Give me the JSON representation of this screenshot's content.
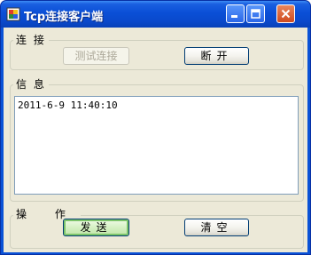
{
  "window": {
    "title": "Tcp连接客户端"
  },
  "groups": {
    "connect": {
      "label": "连 接"
    },
    "info": {
      "label": "信 息"
    },
    "operate": {
      "label": "操 作"
    }
  },
  "buttons": {
    "test_connect": "测试连接",
    "disconnect": "断开",
    "send": "发送",
    "clear": "清空"
  },
  "info_text": "2011-6-9 11:40:10"
}
